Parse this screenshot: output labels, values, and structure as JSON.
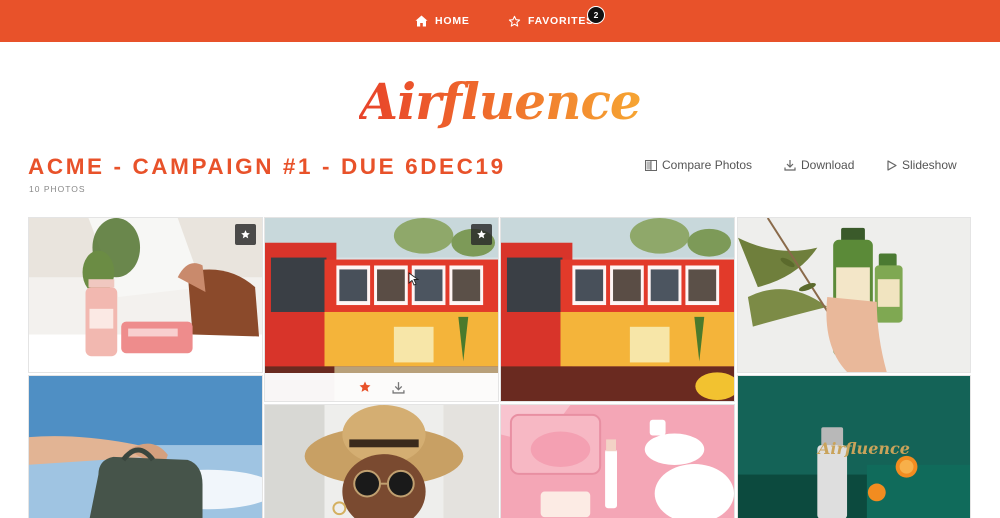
{
  "nav": {
    "home_label": "HOME",
    "favorites_label": "FAVORITES",
    "favorites_count": "2"
  },
  "brand": {
    "logo_text": "Airfluence",
    "colors": {
      "primary": "#e8522a",
      "gradient_end": "#f6a532"
    }
  },
  "album": {
    "title": "ACME - CAMPAIGN #1 - DUE 6DEC19",
    "photo_count": "10 PHOTOS"
  },
  "actions": {
    "compare_label": "Compare Photos",
    "download_label": "Download",
    "slideshow_label": "Slideshow"
  },
  "photos": [
    {
      "subject": "pink spray bottle and face wipes on table",
      "favorited": true
    },
    {
      "subject": "red and yellow city bus",
      "favorited": true,
      "hovered": true
    },
    {
      "subject": "red and yellow city bus",
      "favorited": false
    },
    {
      "subject": "hand holding green Maui shampoo bottle with olive branch",
      "favorited": false
    },
    {
      "subject": "hand holding backpack against sky",
      "favorited": false
    },
    {
      "subject": "woman in straw hat and round sunglasses",
      "favorited": false
    },
    {
      "subject": "pink skincare products flatlay",
      "favorited": false
    },
    {
      "subject": "white bottle on teal background with oranges",
      "favorited": false,
      "overlay_text": "Airfluence"
    }
  ],
  "icons": {
    "home": "home-icon",
    "favorites": "star-outline-icon",
    "compare": "compare-icon",
    "download": "download-icon",
    "slideshow": "play-icon",
    "favorite_badge": "star-icon"
  }
}
